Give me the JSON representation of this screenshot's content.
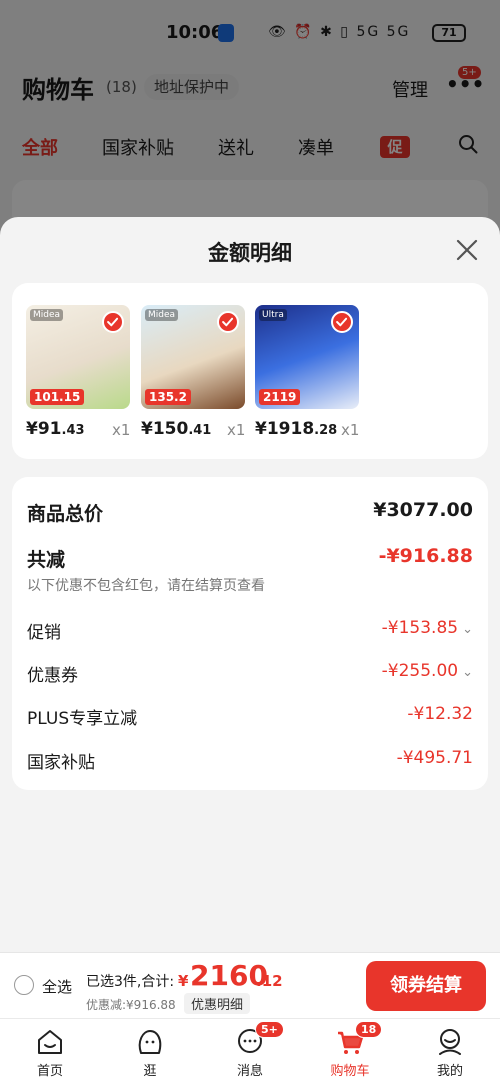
{
  "status_bar": {
    "time": "10:06",
    "icons": "👁 ⏰ ✱ ▯ 5G 5G",
    "battery": "71"
  },
  "header": {
    "title": "购物车",
    "count": "(18)",
    "address_protect": "地址保护中",
    "manage": "管理",
    "more_badge": "5+"
  },
  "filter_tabs": [
    {
      "label": "全部",
      "active": true
    },
    {
      "label": "国家补贴"
    },
    {
      "label": "送礼"
    },
    {
      "label": "凑单"
    }
  ],
  "promo_chip": "促",
  "sheet": {
    "title": "金额明细",
    "products": [
      {
        "price_int": "¥91",
        "price_dec": ".43",
        "qty": "x1",
        "img_tag": "Midea",
        "img_price": "101.15"
      },
      {
        "price_int": "¥150",
        "price_dec": ".41",
        "qty": "x1",
        "img_tag": "Midea",
        "img_price": "135.2"
      },
      {
        "price_int": "¥1918",
        "price_dec": ".28",
        "qty": "x1",
        "img_tag": "Ultra",
        "img_price": "2119"
      }
    ],
    "summary": {
      "total_label": "商品总价",
      "total_value": "¥3077.00",
      "reduce_label": "共减",
      "reduce_value": "-¥916.88",
      "reduce_note": "以下优惠不包含红包，请在结算页查看",
      "items": [
        {
          "label": "促销",
          "value": "-¥153.85",
          "expandable": true
        },
        {
          "label": "优惠券",
          "value": "-¥255.00",
          "expandable": true
        },
        {
          "label": "PLUS专享立减",
          "value": "-¥12.32",
          "expandable": false
        },
        {
          "label": "国家补贴",
          "value": "-¥495.71",
          "expandable": false
        }
      ]
    }
  },
  "checkout": {
    "select_all": "全选",
    "selected_text": "已选3件,合计:",
    "total_symbol": "¥",
    "total_int": "2160",
    "total_dec": ".12",
    "discount_text": "优惠减:¥916.88",
    "detail_link": "优惠明细",
    "button": "领券结算"
  },
  "tabbar": [
    {
      "label": "首页",
      "icon": "home-icon"
    },
    {
      "label": "逛",
      "icon": "browse-face-icon"
    },
    {
      "label": "消息",
      "icon": "message-icon",
      "badge": "5+"
    },
    {
      "label": "购物车",
      "icon": "cart-icon",
      "badge": "18",
      "active": true
    },
    {
      "label": "我的",
      "icon": "profile-icon"
    }
  ],
  "colors": {
    "accent": "#e8352b",
    "sheet_bg": "#f3f3f3"
  }
}
